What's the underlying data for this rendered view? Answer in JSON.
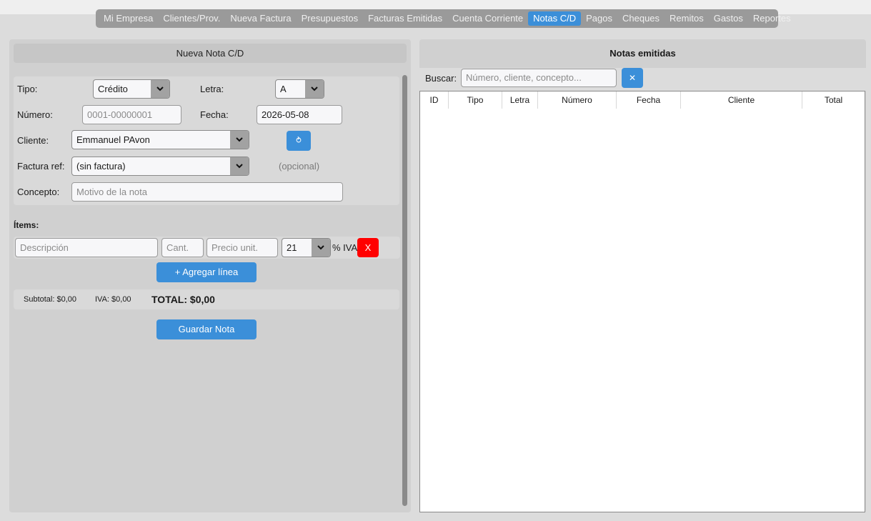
{
  "nav": {
    "tabs": [
      {
        "label": "Mi Empresa",
        "active": false
      },
      {
        "label": "Clientes/Prov.",
        "active": false
      },
      {
        "label": "Nueva Factura",
        "active": false
      },
      {
        "label": "Presupuestos",
        "active": false
      },
      {
        "label": "Facturas Emitidas",
        "active": false
      },
      {
        "label": "Cuenta Corriente",
        "active": false
      },
      {
        "label": "Notas C/D",
        "active": true
      },
      {
        "label": "Pagos",
        "active": false
      },
      {
        "label": "Cheques",
        "active": false
      },
      {
        "label": "Remitos",
        "active": false
      },
      {
        "label": "Gastos",
        "active": false
      },
      {
        "label": "Reportes",
        "active": false
      }
    ]
  },
  "form": {
    "title": "Nueva Nota C/D",
    "tipo_label": "Tipo:",
    "tipo_value": "Crédito",
    "letra_label": "Letra:",
    "letra_value": "A",
    "numero_label": "Número:",
    "numero_placeholder": "0001-00000001",
    "fecha_label": "Fecha:",
    "fecha_value": "2026-05-08",
    "cliente_label": "Cliente:",
    "cliente_value": "Emmanuel PAvon",
    "cliente_refresh_icon": "⥁",
    "factura_label": "Factura ref:",
    "factura_value": "(sin factura)",
    "factura_hint": "(opcional)",
    "concepto_label": "Concepto:",
    "concepto_placeholder": "Motivo de la nota"
  },
  "items": {
    "label": "Ítems:",
    "descripcion_placeholder": "Descripción",
    "cant_placeholder": "Cant.",
    "precio_placeholder": "Precio unit.",
    "iva_value": "21",
    "iva_suffix": "% IVA",
    "remove_label": "X",
    "add_label": "+ Agregar línea"
  },
  "totals": {
    "subtotal": "Subtotal: $0,00",
    "iva": "IVA: $0,00",
    "total": "TOTAL: $0,00"
  },
  "save_label": "Guardar Nota",
  "list": {
    "title": "Notas emitidas",
    "search_label": "Buscar:",
    "search_placeholder": "Número, cliente, concepto...",
    "clear_icon": "✕",
    "columns": [
      "ID",
      "Tipo",
      "Letra",
      "Número",
      "Fecha",
      "Cliente",
      "Total"
    ]
  },
  "colors": {
    "accent": "#3b8fd9",
    "danger": "#ff0000",
    "panel": "#d0d0d0"
  }
}
